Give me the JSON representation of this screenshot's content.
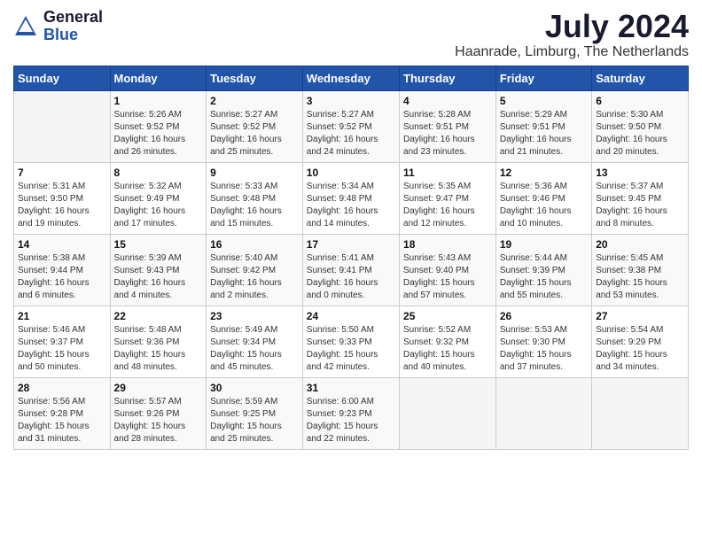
{
  "header": {
    "logo_general": "General",
    "logo_blue": "Blue",
    "month_title": "July 2024",
    "location": "Haanrade, Limburg, The Netherlands"
  },
  "weekdays": [
    "Sunday",
    "Monday",
    "Tuesday",
    "Wednesday",
    "Thursday",
    "Friday",
    "Saturday"
  ],
  "weeks": [
    [
      {
        "day": "",
        "empty": true
      },
      {
        "day": "1",
        "sunrise": "5:26 AM",
        "sunset": "9:52 PM",
        "daylight": "16 hours and 26 minutes."
      },
      {
        "day": "2",
        "sunrise": "5:27 AM",
        "sunset": "9:52 PM",
        "daylight": "16 hours and 25 minutes."
      },
      {
        "day": "3",
        "sunrise": "5:27 AM",
        "sunset": "9:52 PM",
        "daylight": "16 hours and 24 minutes."
      },
      {
        "day": "4",
        "sunrise": "5:28 AM",
        "sunset": "9:51 PM",
        "daylight": "16 hours and 23 minutes."
      },
      {
        "day": "5",
        "sunrise": "5:29 AM",
        "sunset": "9:51 PM",
        "daylight": "16 hours and 21 minutes."
      },
      {
        "day": "6",
        "sunrise": "5:30 AM",
        "sunset": "9:50 PM",
        "daylight": "16 hours and 20 minutes."
      }
    ],
    [
      {
        "day": "7",
        "sunrise": "5:31 AM",
        "sunset": "9:50 PM",
        "daylight": "16 hours and 19 minutes."
      },
      {
        "day": "8",
        "sunrise": "5:32 AM",
        "sunset": "9:49 PM",
        "daylight": "16 hours and 17 minutes."
      },
      {
        "day": "9",
        "sunrise": "5:33 AM",
        "sunset": "9:48 PM",
        "daylight": "16 hours and 15 minutes."
      },
      {
        "day": "10",
        "sunrise": "5:34 AM",
        "sunset": "9:48 PM",
        "daylight": "16 hours and 14 minutes."
      },
      {
        "day": "11",
        "sunrise": "5:35 AM",
        "sunset": "9:47 PM",
        "daylight": "16 hours and 12 minutes."
      },
      {
        "day": "12",
        "sunrise": "5:36 AM",
        "sunset": "9:46 PM",
        "daylight": "16 hours and 10 minutes."
      },
      {
        "day": "13",
        "sunrise": "5:37 AM",
        "sunset": "9:45 PM",
        "daylight": "16 hours and 8 minutes."
      }
    ],
    [
      {
        "day": "14",
        "sunrise": "5:38 AM",
        "sunset": "9:44 PM",
        "daylight": "16 hours and 6 minutes."
      },
      {
        "day": "15",
        "sunrise": "5:39 AM",
        "sunset": "9:43 PM",
        "daylight": "16 hours and 4 minutes."
      },
      {
        "day": "16",
        "sunrise": "5:40 AM",
        "sunset": "9:42 PM",
        "daylight": "16 hours and 2 minutes."
      },
      {
        "day": "17",
        "sunrise": "5:41 AM",
        "sunset": "9:41 PM",
        "daylight": "16 hours and 0 minutes."
      },
      {
        "day": "18",
        "sunrise": "5:43 AM",
        "sunset": "9:40 PM",
        "daylight": "15 hours and 57 minutes."
      },
      {
        "day": "19",
        "sunrise": "5:44 AM",
        "sunset": "9:39 PM",
        "daylight": "15 hours and 55 minutes."
      },
      {
        "day": "20",
        "sunrise": "5:45 AM",
        "sunset": "9:38 PM",
        "daylight": "15 hours and 53 minutes."
      }
    ],
    [
      {
        "day": "21",
        "sunrise": "5:46 AM",
        "sunset": "9:37 PM",
        "daylight": "15 hours and 50 minutes."
      },
      {
        "day": "22",
        "sunrise": "5:48 AM",
        "sunset": "9:36 PM",
        "daylight": "15 hours and 48 minutes."
      },
      {
        "day": "23",
        "sunrise": "5:49 AM",
        "sunset": "9:34 PM",
        "daylight": "15 hours and 45 minutes."
      },
      {
        "day": "24",
        "sunrise": "5:50 AM",
        "sunset": "9:33 PM",
        "daylight": "15 hours and 42 minutes."
      },
      {
        "day": "25",
        "sunrise": "5:52 AM",
        "sunset": "9:32 PM",
        "daylight": "15 hours and 40 minutes."
      },
      {
        "day": "26",
        "sunrise": "5:53 AM",
        "sunset": "9:30 PM",
        "daylight": "15 hours and 37 minutes."
      },
      {
        "day": "27",
        "sunrise": "5:54 AM",
        "sunset": "9:29 PM",
        "daylight": "15 hours and 34 minutes."
      }
    ],
    [
      {
        "day": "28",
        "sunrise": "5:56 AM",
        "sunset": "9:28 PM",
        "daylight": "15 hours and 31 minutes."
      },
      {
        "day": "29",
        "sunrise": "5:57 AM",
        "sunset": "9:26 PM",
        "daylight": "15 hours and 28 minutes."
      },
      {
        "day": "30",
        "sunrise": "5:59 AM",
        "sunset": "9:25 PM",
        "daylight": "15 hours and 25 minutes."
      },
      {
        "day": "31",
        "sunrise": "6:00 AM",
        "sunset": "9:23 PM",
        "daylight": "15 hours and 22 minutes."
      },
      {
        "day": "",
        "empty": true
      },
      {
        "day": "",
        "empty": true
      },
      {
        "day": "",
        "empty": true
      }
    ]
  ]
}
